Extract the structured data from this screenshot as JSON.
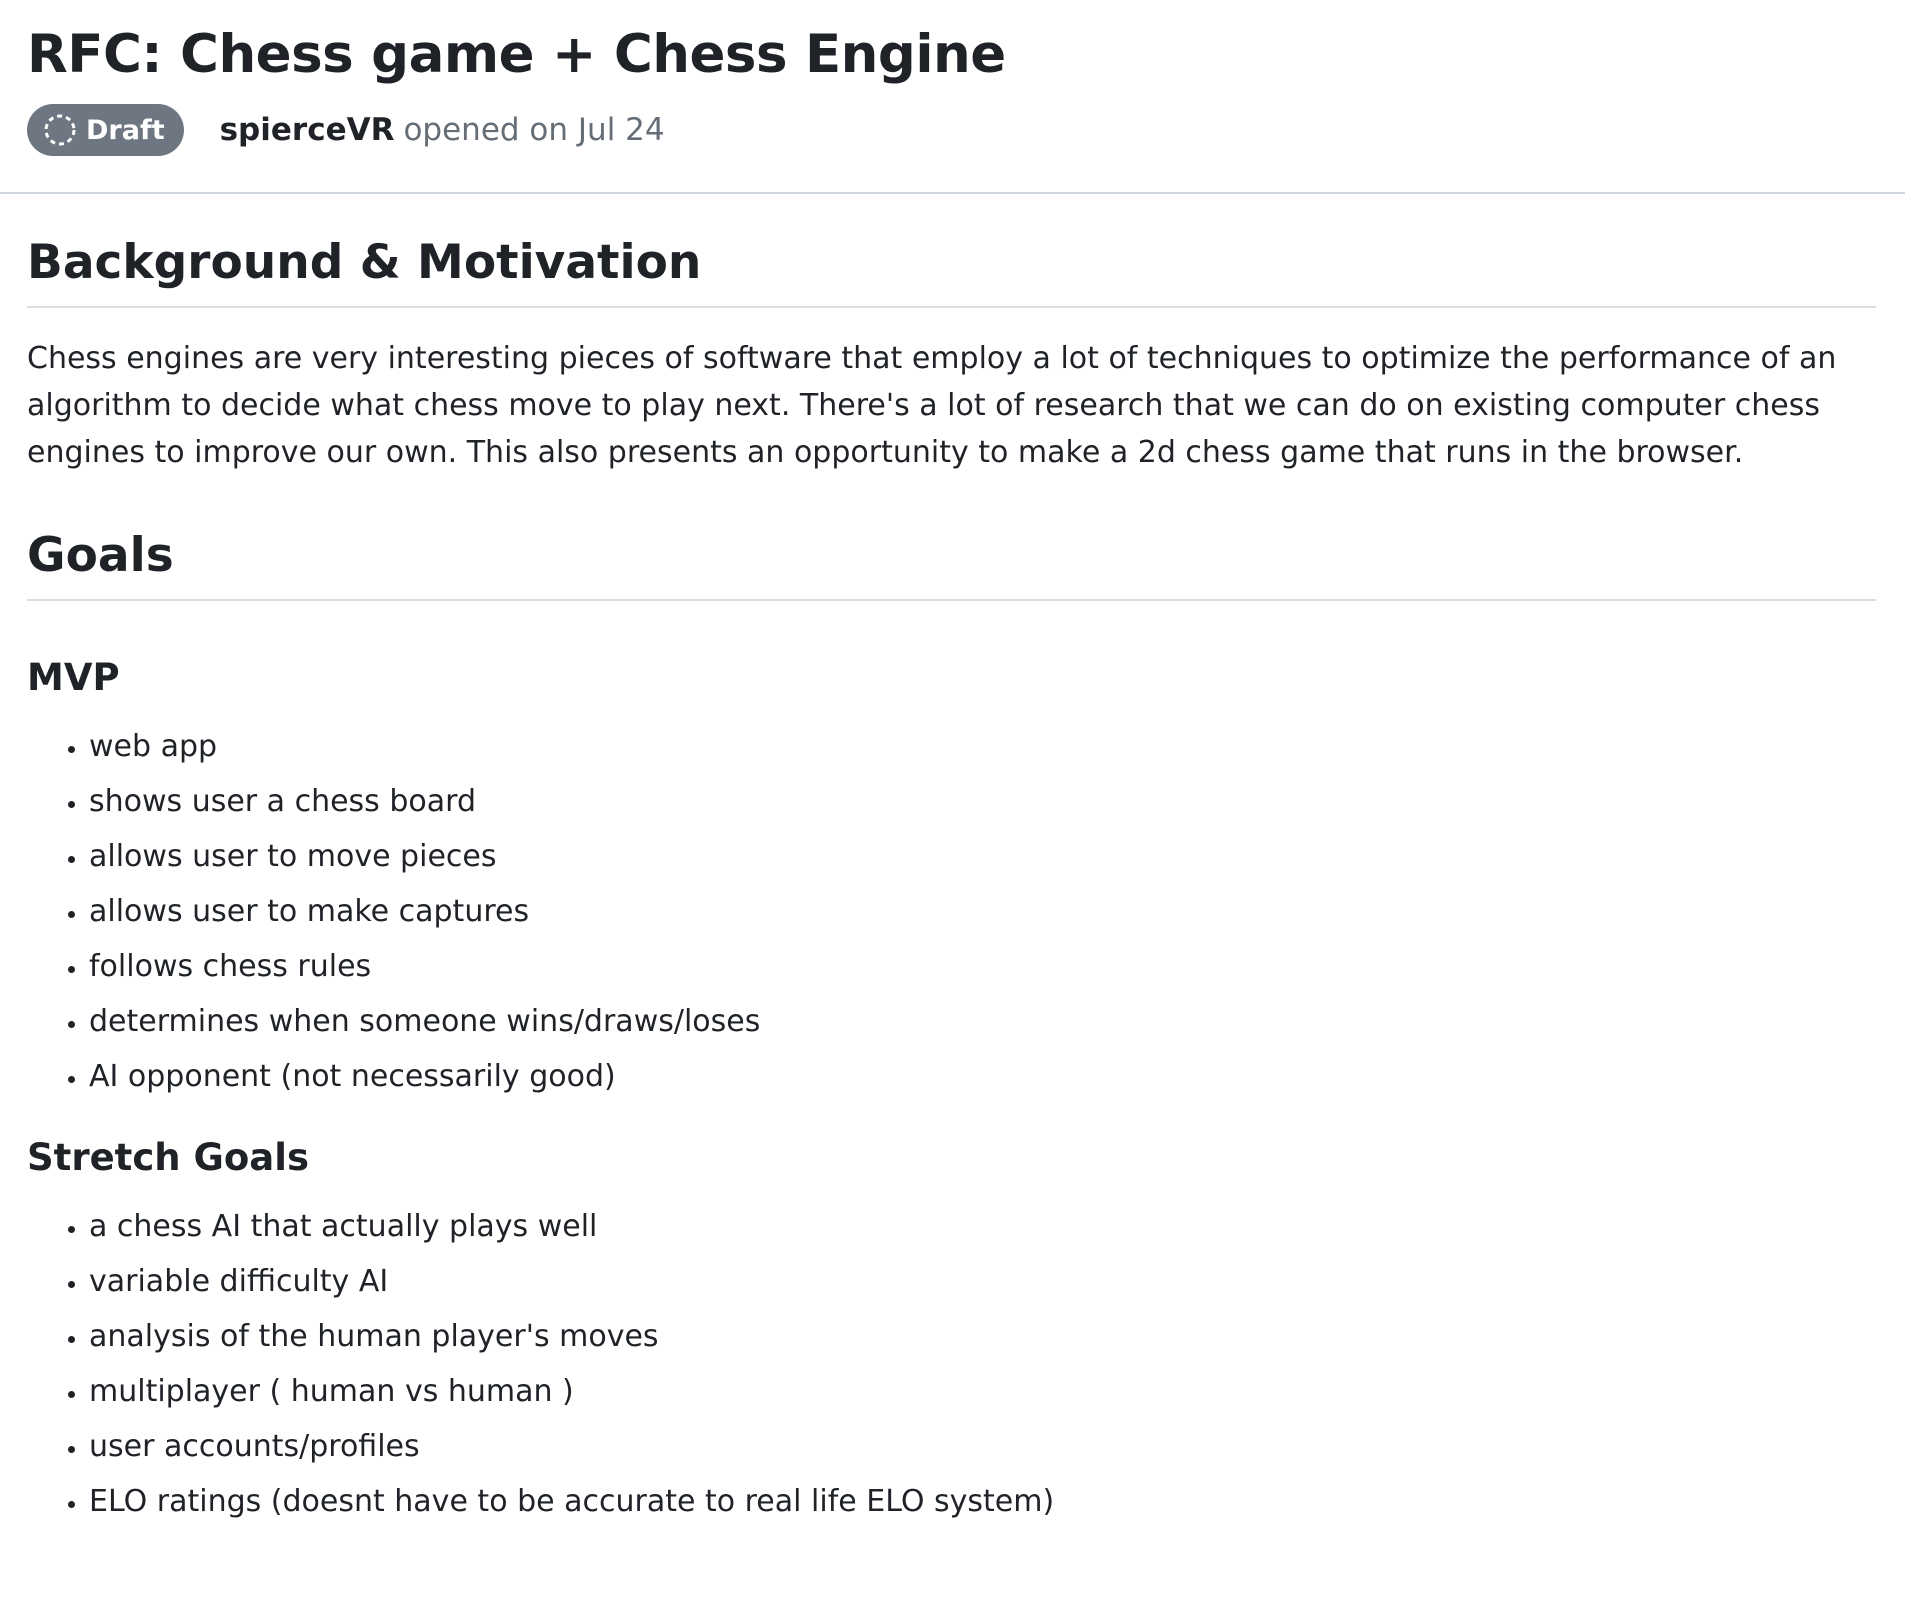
{
  "issue": {
    "title": "RFC: Chess game + Chess Engine",
    "status": "Draft",
    "author": "spierceVR",
    "opened_text": "opened on Jul 24"
  },
  "sections": {
    "background": {
      "heading": "Background & Motivation",
      "paragraph": "Chess engines are very interesting pieces of software that employ a lot of techniques to optimize the performance of an algorithm to decide what chess move to play next. There's a lot of research that we can do on existing computer chess engines to improve our own. This also presents an opportunity to make a 2d chess game that runs in the browser."
    },
    "goals": {
      "heading": "Goals",
      "mvp": {
        "heading": "MVP",
        "items": [
          "web app",
          "shows user a chess board",
          "allows user to move pieces",
          "allows user to make captures",
          "follows chess rules",
          "determines when someone wins/draws/loses",
          "AI opponent (not necessarily good)"
        ]
      },
      "stretch": {
        "heading": "Stretch Goals",
        "items": [
          "a chess AI that actually plays well",
          "variable difficulty AI",
          "analysis of the human player's moves",
          "multiplayer ( human vs human )",
          "user accounts/profiles",
          "ELO ratings (doesnt have to be accurate to real life ELO system)"
        ]
      }
    }
  },
  "colors": {
    "badge_bg": "#6e7781",
    "muted_text": "#656d76",
    "text": "#1f2328",
    "divider": "#d0d7de"
  },
  "icons": {
    "draft_badge_icon": "dashed-circle-icon"
  }
}
